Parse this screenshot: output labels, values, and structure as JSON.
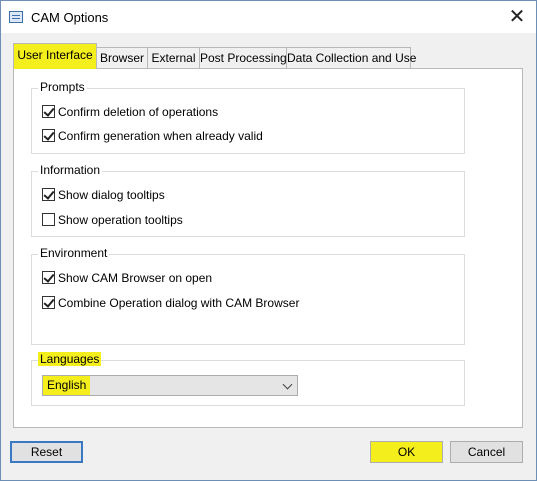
{
  "window": {
    "title": "CAM Options",
    "close_glyph": "✕"
  },
  "tabs": [
    {
      "label": "User Interface",
      "active": true
    },
    {
      "label": "Browser"
    },
    {
      "label": "External"
    },
    {
      "label": "Post Processing"
    },
    {
      "label": "Data Collection and Use"
    }
  ],
  "groups": {
    "prompts": {
      "label": "Prompts",
      "items": [
        {
          "label": "Confirm deletion of operations",
          "checked": true
        },
        {
          "label": "Confirm generation when already valid",
          "checked": true
        }
      ]
    },
    "information": {
      "label": "Information",
      "items": [
        {
          "label": "Show dialog tooltips",
          "checked": true
        },
        {
          "label": "Show operation tooltips",
          "checked": false
        }
      ]
    },
    "environment": {
      "label": "Environment",
      "items": [
        {
          "label": "Show CAM Browser on open",
          "checked": true
        },
        {
          "label": "Combine Operation dialog with CAM Browser",
          "checked": true
        }
      ]
    },
    "languages": {
      "label": "Languages",
      "selected": "English"
    }
  },
  "buttons": {
    "reset": "Reset",
    "ok": "OK",
    "cancel": "Cancel"
  },
  "colors": {
    "highlight": "#f4ee1d",
    "focus": "#3b78c4",
    "border": "#6d8fb5"
  }
}
